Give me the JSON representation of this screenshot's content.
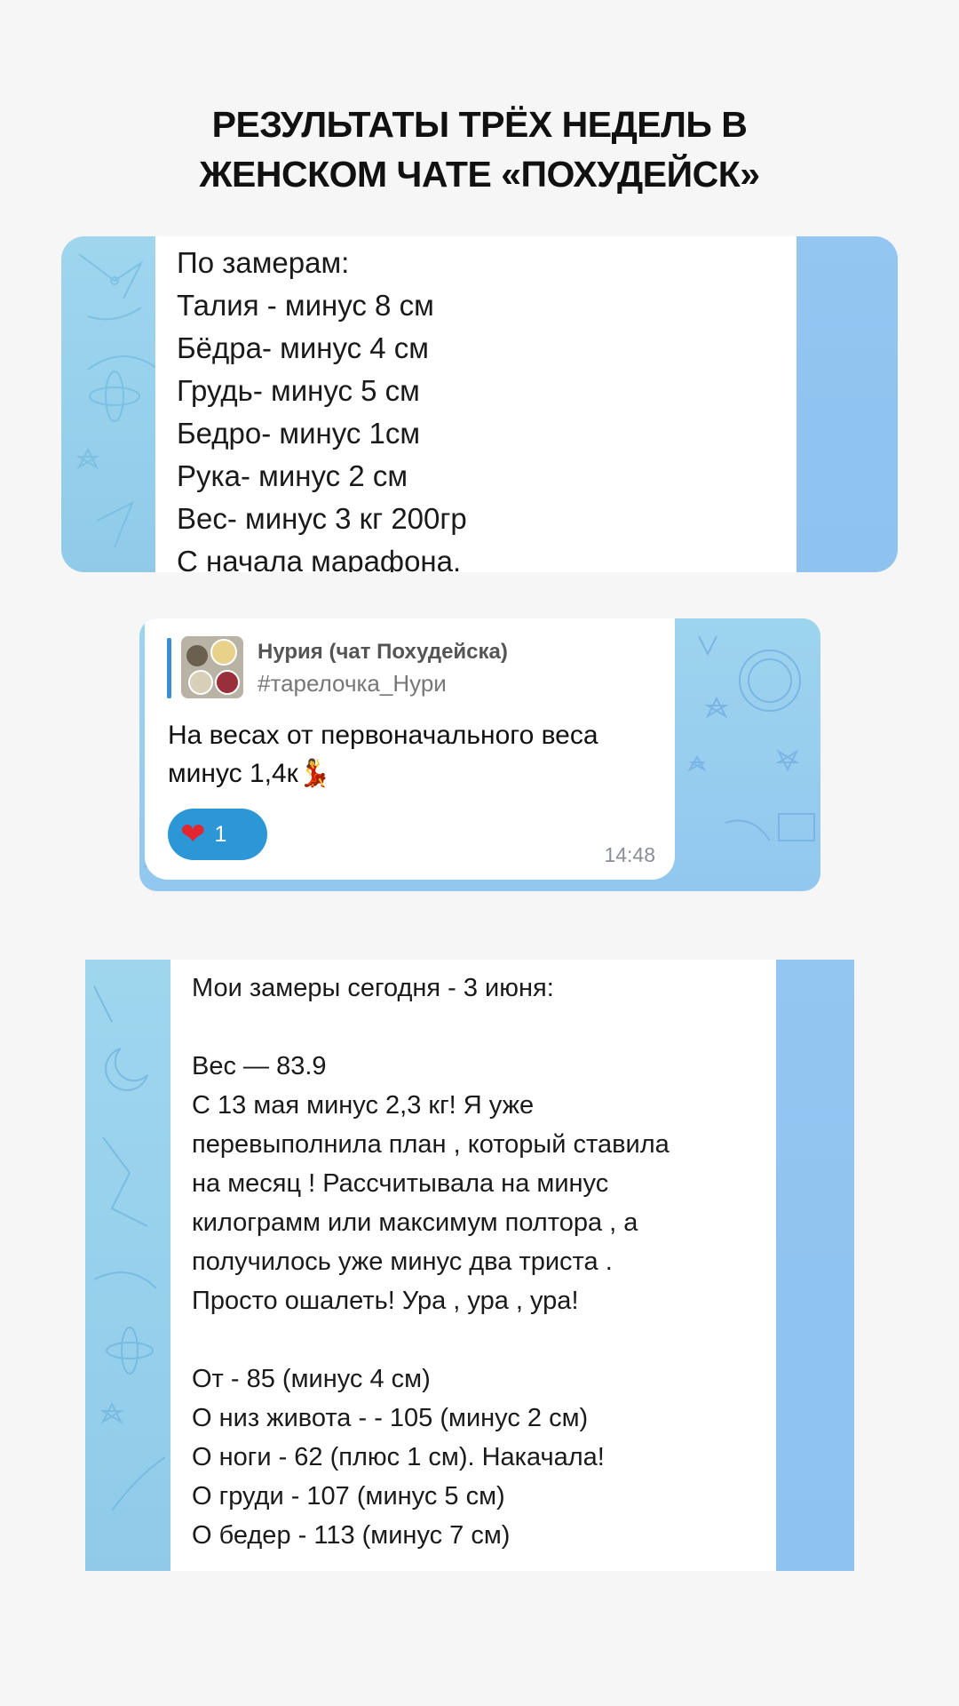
{
  "title": {
    "line1": "РЕЗУЛЬТАТЫ ТРЁХ НЕДЕЛЬ В",
    "line2": "ЖЕНСКОМ ЧАТЕ «ПОХУДЕЙСК»"
  },
  "card1": {
    "lines": [
      "По замерам:",
      "Талия - минус 8 см",
      "Бёдра- минус 4 см",
      "Грудь- минус 5 см",
      "Бедро- минус 1см",
      "Рука- минус 2 см",
      "Вес- минус 3 кг 200гр",
      "С начала марафона."
    ]
  },
  "card2": {
    "quote_author": "Нурия (чат Похудейска)",
    "quote_text": "#тарелочка_Нури",
    "message_line1": "На весах от первоначального веса",
    "message_line2": "минус 1,4к",
    "message_emoji": "💃",
    "reaction_emoji": "❤",
    "reaction_count": "1",
    "time": "14:48"
  },
  "card3": {
    "lines": [
      "Мои замеры сегодня - 3 июня:",
      "",
      "Вес — 83.9",
      "С 13 мая минус 2,3 кг! Я уже",
      "перевыполнила план , который ставила",
      "на месяц ! Рассчитывала на минус",
      "килограмм или максимум полтора , а",
      "получилось уже минус два триста .",
      "Просто ошалеть! Ура , ура , ура!",
      "",
      "От - 85 (минус 4 см)",
      "О низ живота - - 105 (минус 2 см)",
      "О ноги - 62 (плюс 1 см). Накачала!",
      "О груди - 107 (минус 5 см)",
      "О бедер - 113 (минус 7 см)"
    ]
  }
}
